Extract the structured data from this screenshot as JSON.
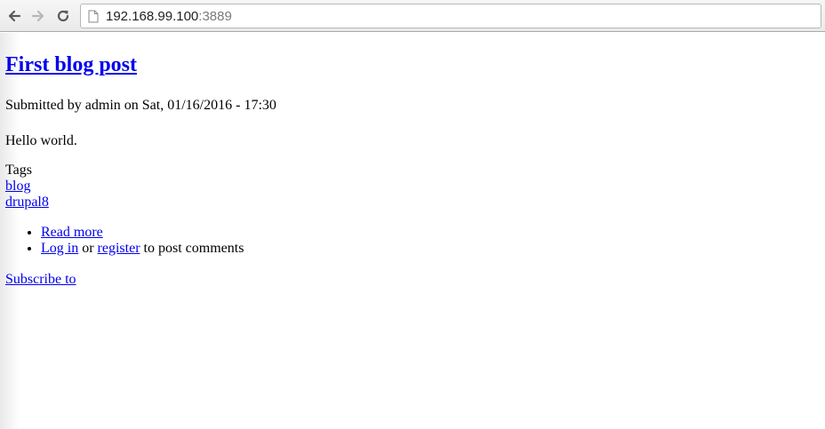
{
  "browser": {
    "back_icon": "arrow-left-icon",
    "forward_icon": "arrow-right-icon",
    "reload_icon": "reload-icon",
    "page_icon": "document-icon",
    "url_host": "192.168.99.100",
    "url_port": ":3889"
  },
  "post": {
    "title": "First blog post",
    "submitted": "Submitted by admin on Sat, 01/16/2016 - 17:30",
    "body": "Hello world.",
    "tags_label": "Tags",
    "tags": [
      "blog",
      "drupal8"
    ]
  },
  "links": {
    "read_more": "Read more",
    "log_in": "Log in",
    "or": " or ",
    "register": "register",
    "post_comments": " to post comments"
  },
  "subscribe": "Subscribe to"
}
